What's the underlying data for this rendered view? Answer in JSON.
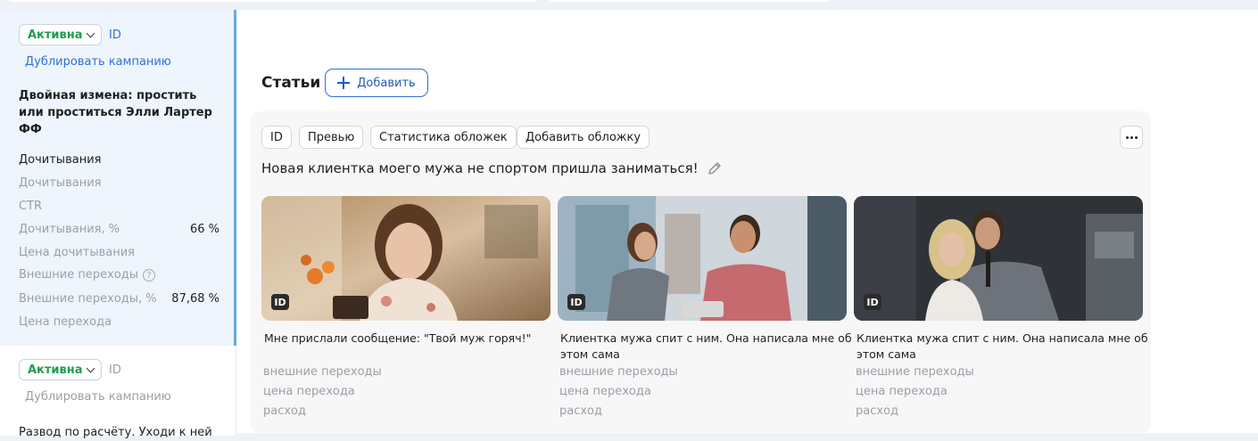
{
  "campaigns": [
    {
      "status_label": "Активна",
      "id_label": "ID",
      "duplicate_label": "Дублировать кампанию",
      "title": "Двойная измена: простить или проститься Элли Лартер ФФ",
      "metrics": [
        {
          "label": "Дочитывания",
          "value": ""
        },
        {
          "label": "Дочитывания",
          "value": ""
        },
        {
          "label": "CTR",
          "value": ""
        },
        {
          "label": "Дочитывания, %",
          "value": "66 %"
        },
        {
          "label": "Цена дочитывания",
          "value": ""
        },
        {
          "label": "Внешние переходы",
          "value": ""
        },
        {
          "label": "Внешние переходы, %",
          "value": "87,68 %"
        },
        {
          "label": "Цена перехода",
          "value": ""
        }
      ]
    },
    {
      "status_label": "Активна",
      "id_label": "ID",
      "duplicate_label": "Дублировать кампанию",
      "title": "Развод по расчёту. Уходи к ней"
    }
  ],
  "articles": {
    "section_title": "Статьи",
    "add_label": "Добавить",
    "toolbar": [
      "ID",
      "Превью",
      "Статистика обложек",
      "Добавить обложку"
    ],
    "headline": "Новая клиентка моего мужа не спортом пришла заниматься!",
    "covers": [
      {
        "badge": "ID",
        "caption": "Мне прислали сообщение: \"Твой муж горяч!\"",
        "stats": [
          "внешние переходы",
          "цена перехода",
          "расход"
        ]
      },
      {
        "badge": "ID",
        "caption": "Клиентка мужа спит с ним. Она написала мне об этом сама",
        "stats": [
          "внешние переходы",
          "цена перехода",
          "расход"
        ]
      },
      {
        "badge": "ID",
        "caption": "Клиентка мужа спит с ним. Она написала мне об этом сама",
        "stats": [
          "внешние переходы",
          "цена перехода",
          "расход"
        ]
      }
    ]
  },
  "colors": {
    "accent": "#2f6fdf",
    "status_green": "#1e9d4b",
    "muted_text": "#9aa0a8",
    "selected_bg": "#eef5fd"
  }
}
